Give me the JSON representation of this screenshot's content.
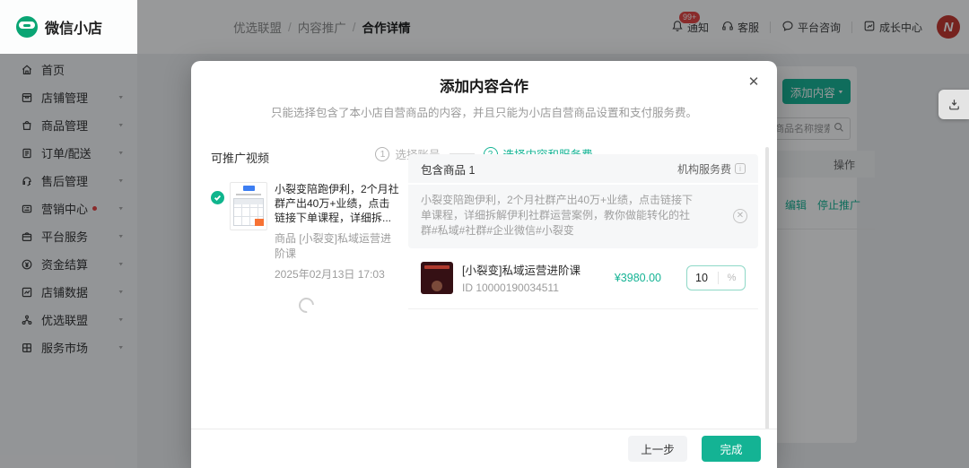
{
  "app": {
    "logo_text": "微信小店"
  },
  "sidebar": {
    "items": [
      {
        "label": "首页"
      },
      {
        "label": "店铺管理"
      },
      {
        "label": "商品管理"
      },
      {
        "label": "订单/配送"
      },
      {
        "label": "售后管理"
      },
      {
        "label": "营销中心"
      },
      {
        "label": "平台服务"
      },
      {
        "label": "资金结算"
      },
      {
        "label": "店铺数据"
      },
      {
        "label": "优选联盟"
      },
      {
        "label": "服务市场"
      }
    ]
  },
  "header": {
    "breadcrumb": {
      "level1": "优选联盟",
      "level2": "内容推广",
      "current": "合作详情"
    },
    "actions": {
      "notice": "通知",
      "notice_badge": "99+",
      "service": "客服",
      "consult": "平台咨询",
      "growth": "成长中心",
      "avatar_letter": "N"
    }
  },
  "background": {
    "add_content_label": "添加内容",
    "search_placeholder": "商品名称搜索",
    "table_action_header": "操作",
    "row_action_edit": "编辑",
    "row_action_stop": "停止推广"
  },
  "modal": {
    "title": "添加内容合作",
    "subtitle": "只能选择包含了本小店自营商品的内容，并且只能为小店自营商品设置和支付服务费。",
    "steps": {
      "step1_num": "1",
      "step1_label": "选择账号",
      "step2_num": "2",
      "step2_label": "选择内容和服务费"
    },
    "left": {
      "section_title": "可推广视频",
      "video": {
        "title": "小裂变陪跑伊利，2个月社群产出40万+业绩，点击链接下单课程，详细拆...",
        "product_line": "商品 [小裂变]私域运营进阶课",
        "date": "2025年02月13日 17:03"
      }
    },
    "right": {
      "included_title": "包含商品 1",
      "fee_label": "机构服务费",
      "description": "小裂变陪跑伊利，2个月社群产出40万+业绩，点击链接下单课程，详细拆解伊利社群运营案例，教你做能转化的社群#私域#社群#企业微信#小裂变",
      "product": {
        "name": "[小裂变]私域运营进阶课",
        "id": "ID 10000190034511",
        "price": "¥3980.00",
        "fee_value": "10",
        "fee_unit": "%"
      }
    },
    "footer": {
      "prev_label": "上一步",
      "done_label": "完成"
    }
  },
  "colors": {
    "accent": "#14b394",
    "badge_red": "#e64340",
    "avatar_red": "#c5342c"
  }
}
